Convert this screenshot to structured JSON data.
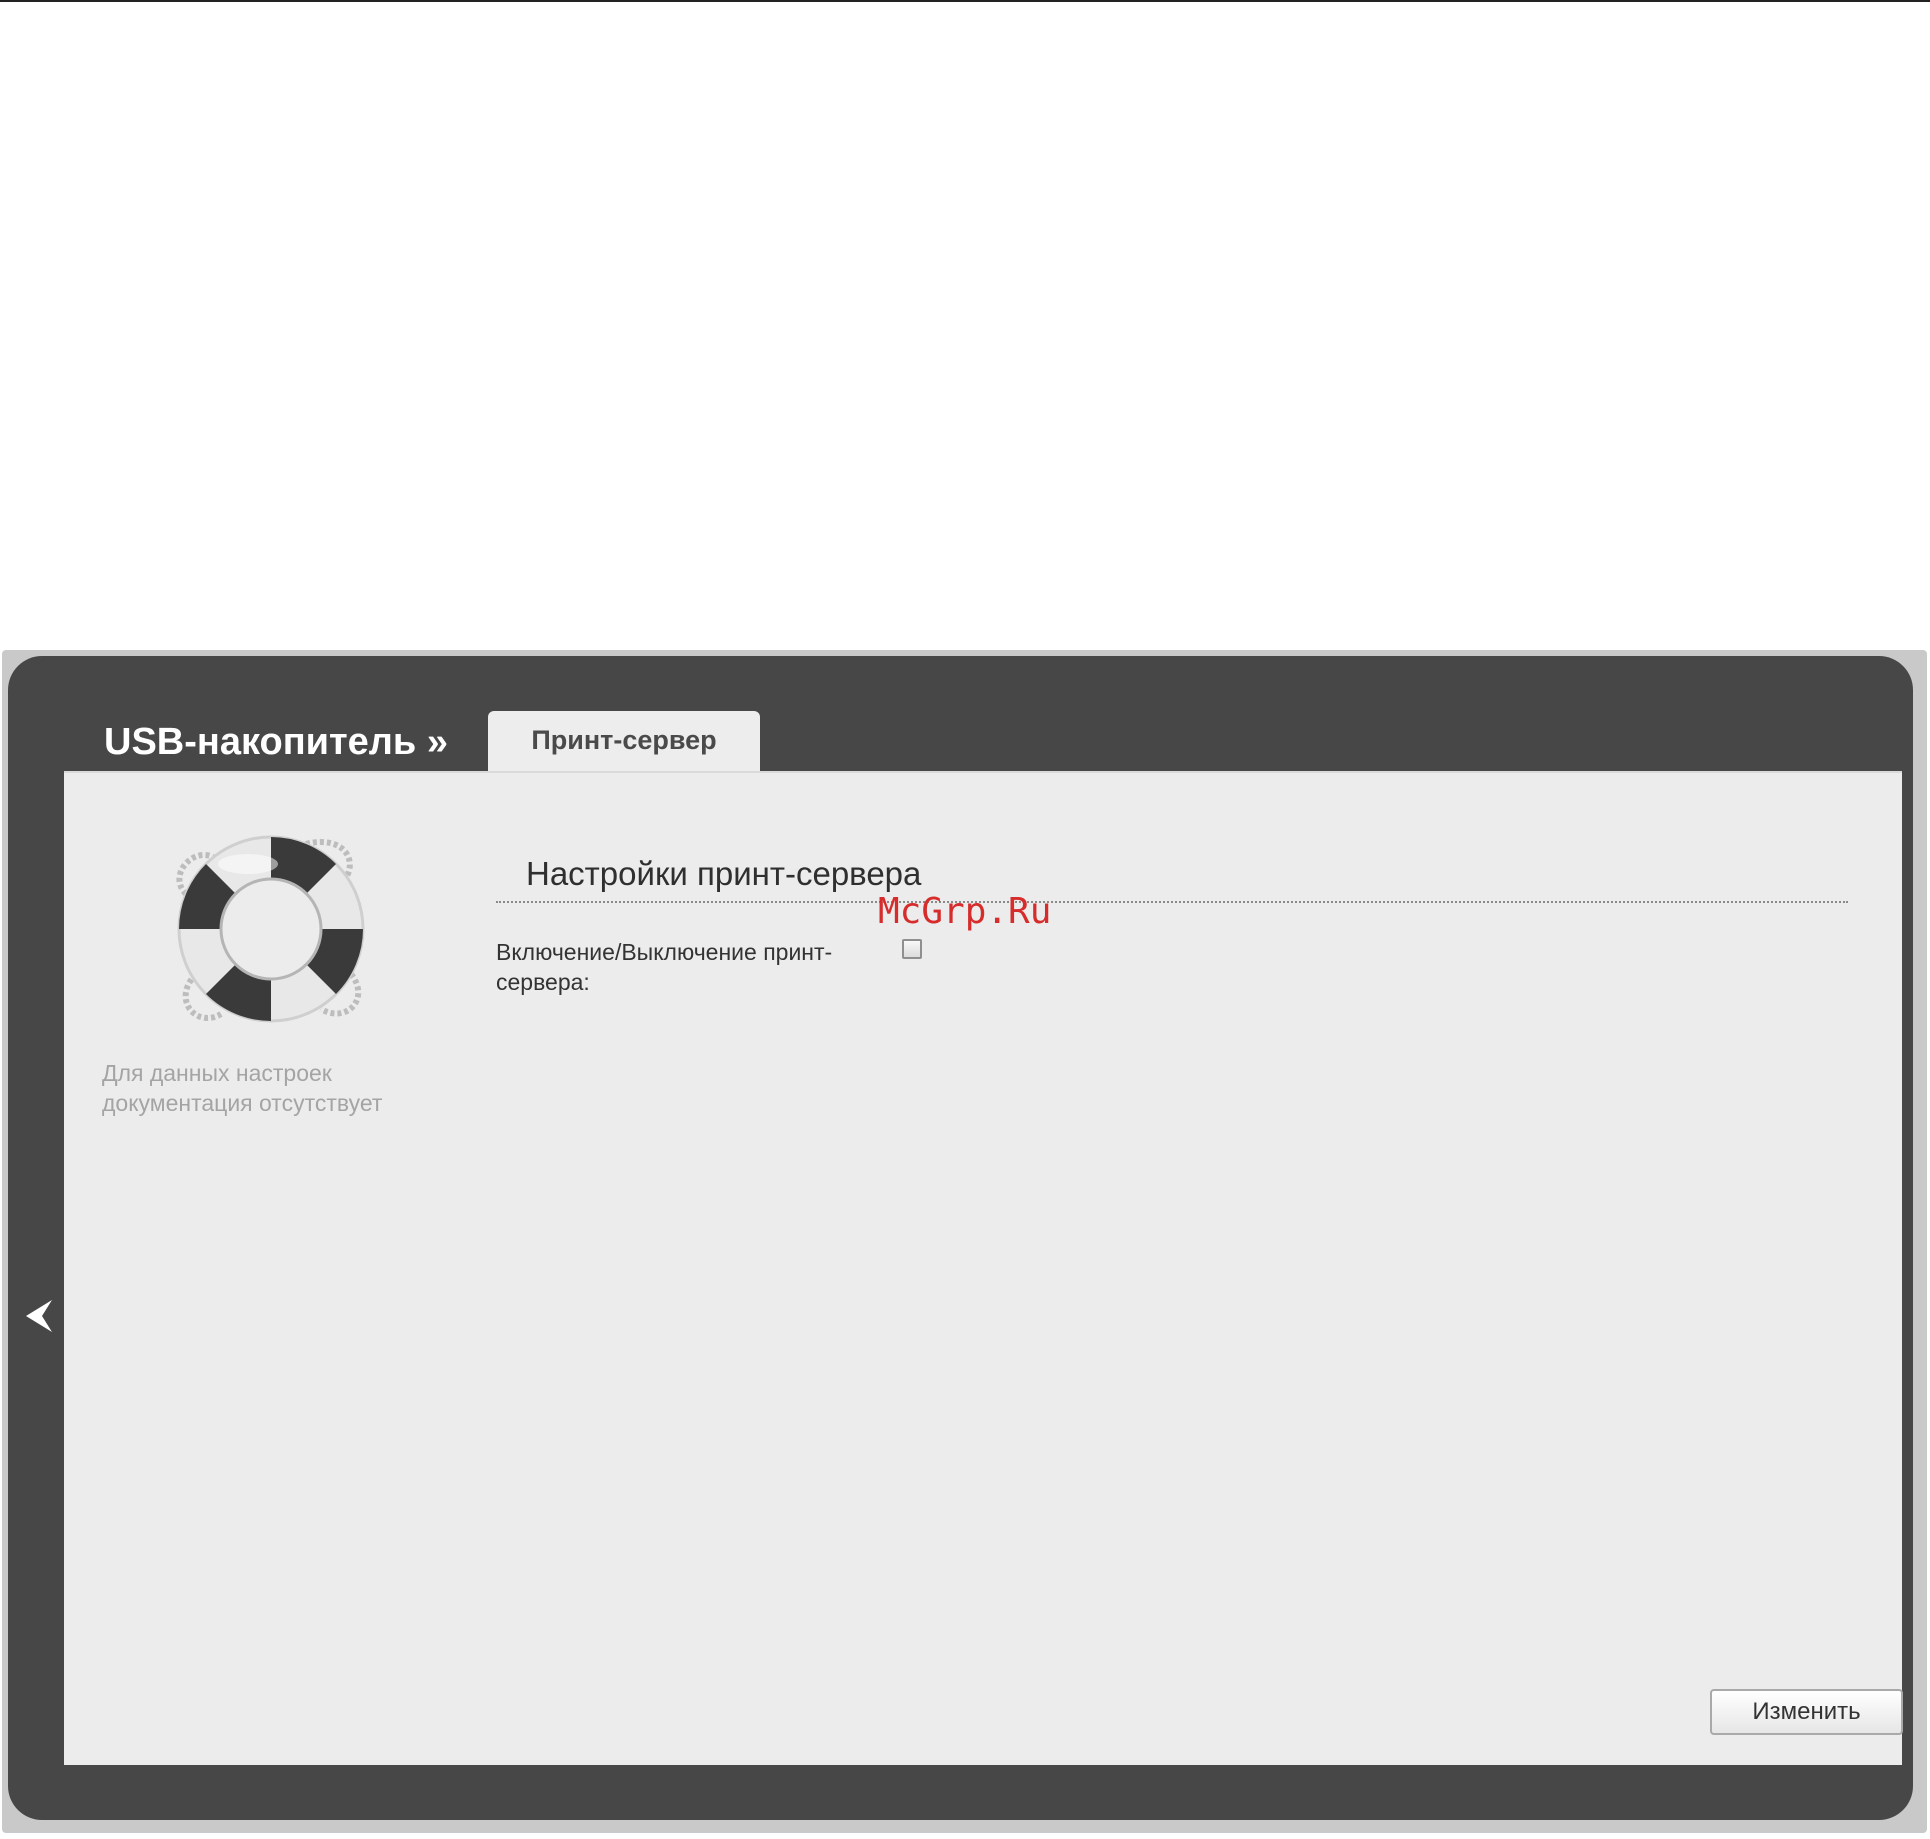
{
  "header": {
    "section_title": "USB-накопитель »",
    "active_tab": "Принт-сервер"
  },
  "sidebar": {
    "help_text": "Для данных настроек документация отсутствует",
    "icon": "lifebuoy-icon"
  },
  "main": {
    "heading": "Настройки принт-сервера",
    "fields": [
      {
        "label": "Включение/Выключение принт-сервера:",
        "type": "checkbox",
        "checked": false
      }
    ],
    "submit_label": "Изменить"
  },
  "navigation": {
    "back_icon": "chevron-left-icon"
  },
  "watermark": "McGrp.Ru",
  "colors": {
    "shell": "#474747",
    "panel": "#ececec",
    "watermark": "#d62c2c"
  }
}
